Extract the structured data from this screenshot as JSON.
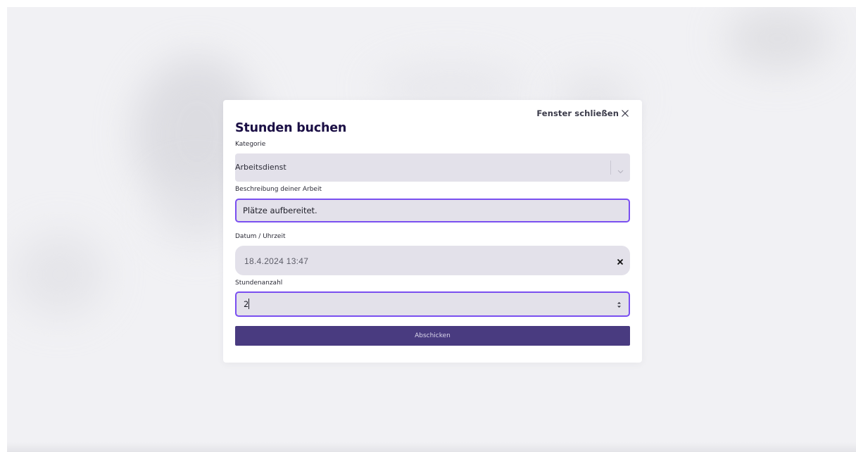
{
  "modal": {
    "close_label": "Fenster schließen",
    "title": "Stunden buchen"
  },
  "form": {
    "category": {
      "label": "Kategorie",
      "selected": "Arbeitsdienst"
    },
    "description": {
      "label": "Beschreibung deiner Arbeit",
      "value": "Plätze aufbereitet."
    },
    "datetime": {
      "label": "Datum / Uhrzeit",
      "value": "18.4.2024 13:47"
    },
    "hours": {
      "label": "Stundenanzahl",
      "value": "2"
    },
    "submit_label": "Abschicken"
  },
  "icons": {
    "close": "close-icon",
    "select": "chevron-down-icon",
    "clear": "clear-icon",
    "stepper": "stepper-arrows-icon"
  },
  "colors": {
    "accent": "#7a4ff0",
    "button": "#493b80",
    "field_bg": "#e3e1ea",
    "title": "#1b0f45"
  }
}
